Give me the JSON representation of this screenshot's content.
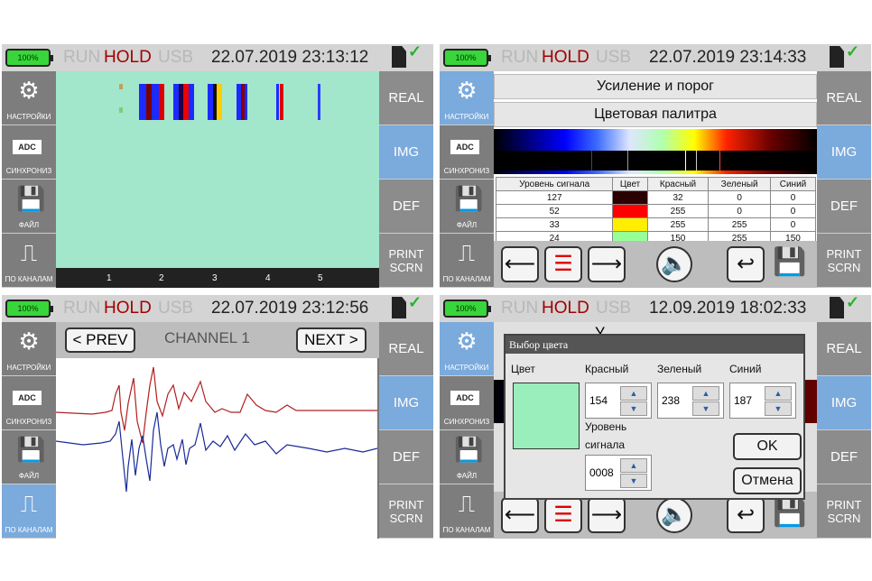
{
  "status": {
    "battery": "100%",
    "run": "RUN",
    "hold": "HOLD",
    "usb": "USB"
  },
  "panels": [
    {
      "datetime": "22.07.2019 23:13:12"
    },
    {
      "datetime": "22.07.2019 23:14:33"
    },
    {
      "datetime": "22.07.2019 23:12:56"
    },
    {
      "datetime": "12.09.2019 18:02:33"
    }
  ],
  "left_menu": {
    "settings": "НАСТРОЙКИ",
    "sync": "СИНХРОНИЗ",
    "file": "ФАЙЛ",
    "channels": "ПО КАНАЛАМ",
    "adc": "ADC"
  },
  "right_menu": {
    "real": "REAL",
    "img": "IMG",
    "def": "DEF",
    "print1": "PRINT",
    "print2": "SCRN"
  },
  "waterfall": {
    "ticks": [
      "1",
      "2",
      "3",
      "4",
      "5"
    ]
  },
  "settings_page": {
    "gain_btn": "Усиление и порог",
    "palette_btn": "Цветовая палитра",
    "table_headers": [
      "Уровень сигнала",
      "Цвет",
      "Красный",
      "Зеленый",
      "Синий"
    ],
    "rows": [
      {
        "level": "127",
        "color": "#2b0000",
        "r": "32",
        "g": "0",
        "b": "0"
      },
      {
        "level": "52",
        "color": "#ff0000",
        "r": "255",
        "g": "0",
        "b": "0"
      },
      {
        "level": "33",
        "color": "#ffee00",
        "r": "255",
        "g": "255",
        "b": "0"
      },
      {
        "level": "24",
        "color": "#96ff96",
        "r": "150",
        "g": "255",
        "b": "150"
      }
    ]
  },
  "channel_view": {
    "prev": "< PREV",
    "next": "NEXT >",
    "title": "CHANNEL 1"
  },
  "color_dialog": {
    "title": "Выбор цвета",
    "color_label": "Цвет",
    "red_label": "Красный",
    "green_label": "Зеленый",
    "blue_label": "Синий",
    "red": "154",
    "green": "238",
    "blue": "187",
    "level_label1": "Уровень",
    "level_label2": "сигнала",
    "level": "0008",
    "ok": "OK",
    "cancel": "Отмена",
    "swatch": "#9aeebb",
    "behind_char": "У"
  }
}
